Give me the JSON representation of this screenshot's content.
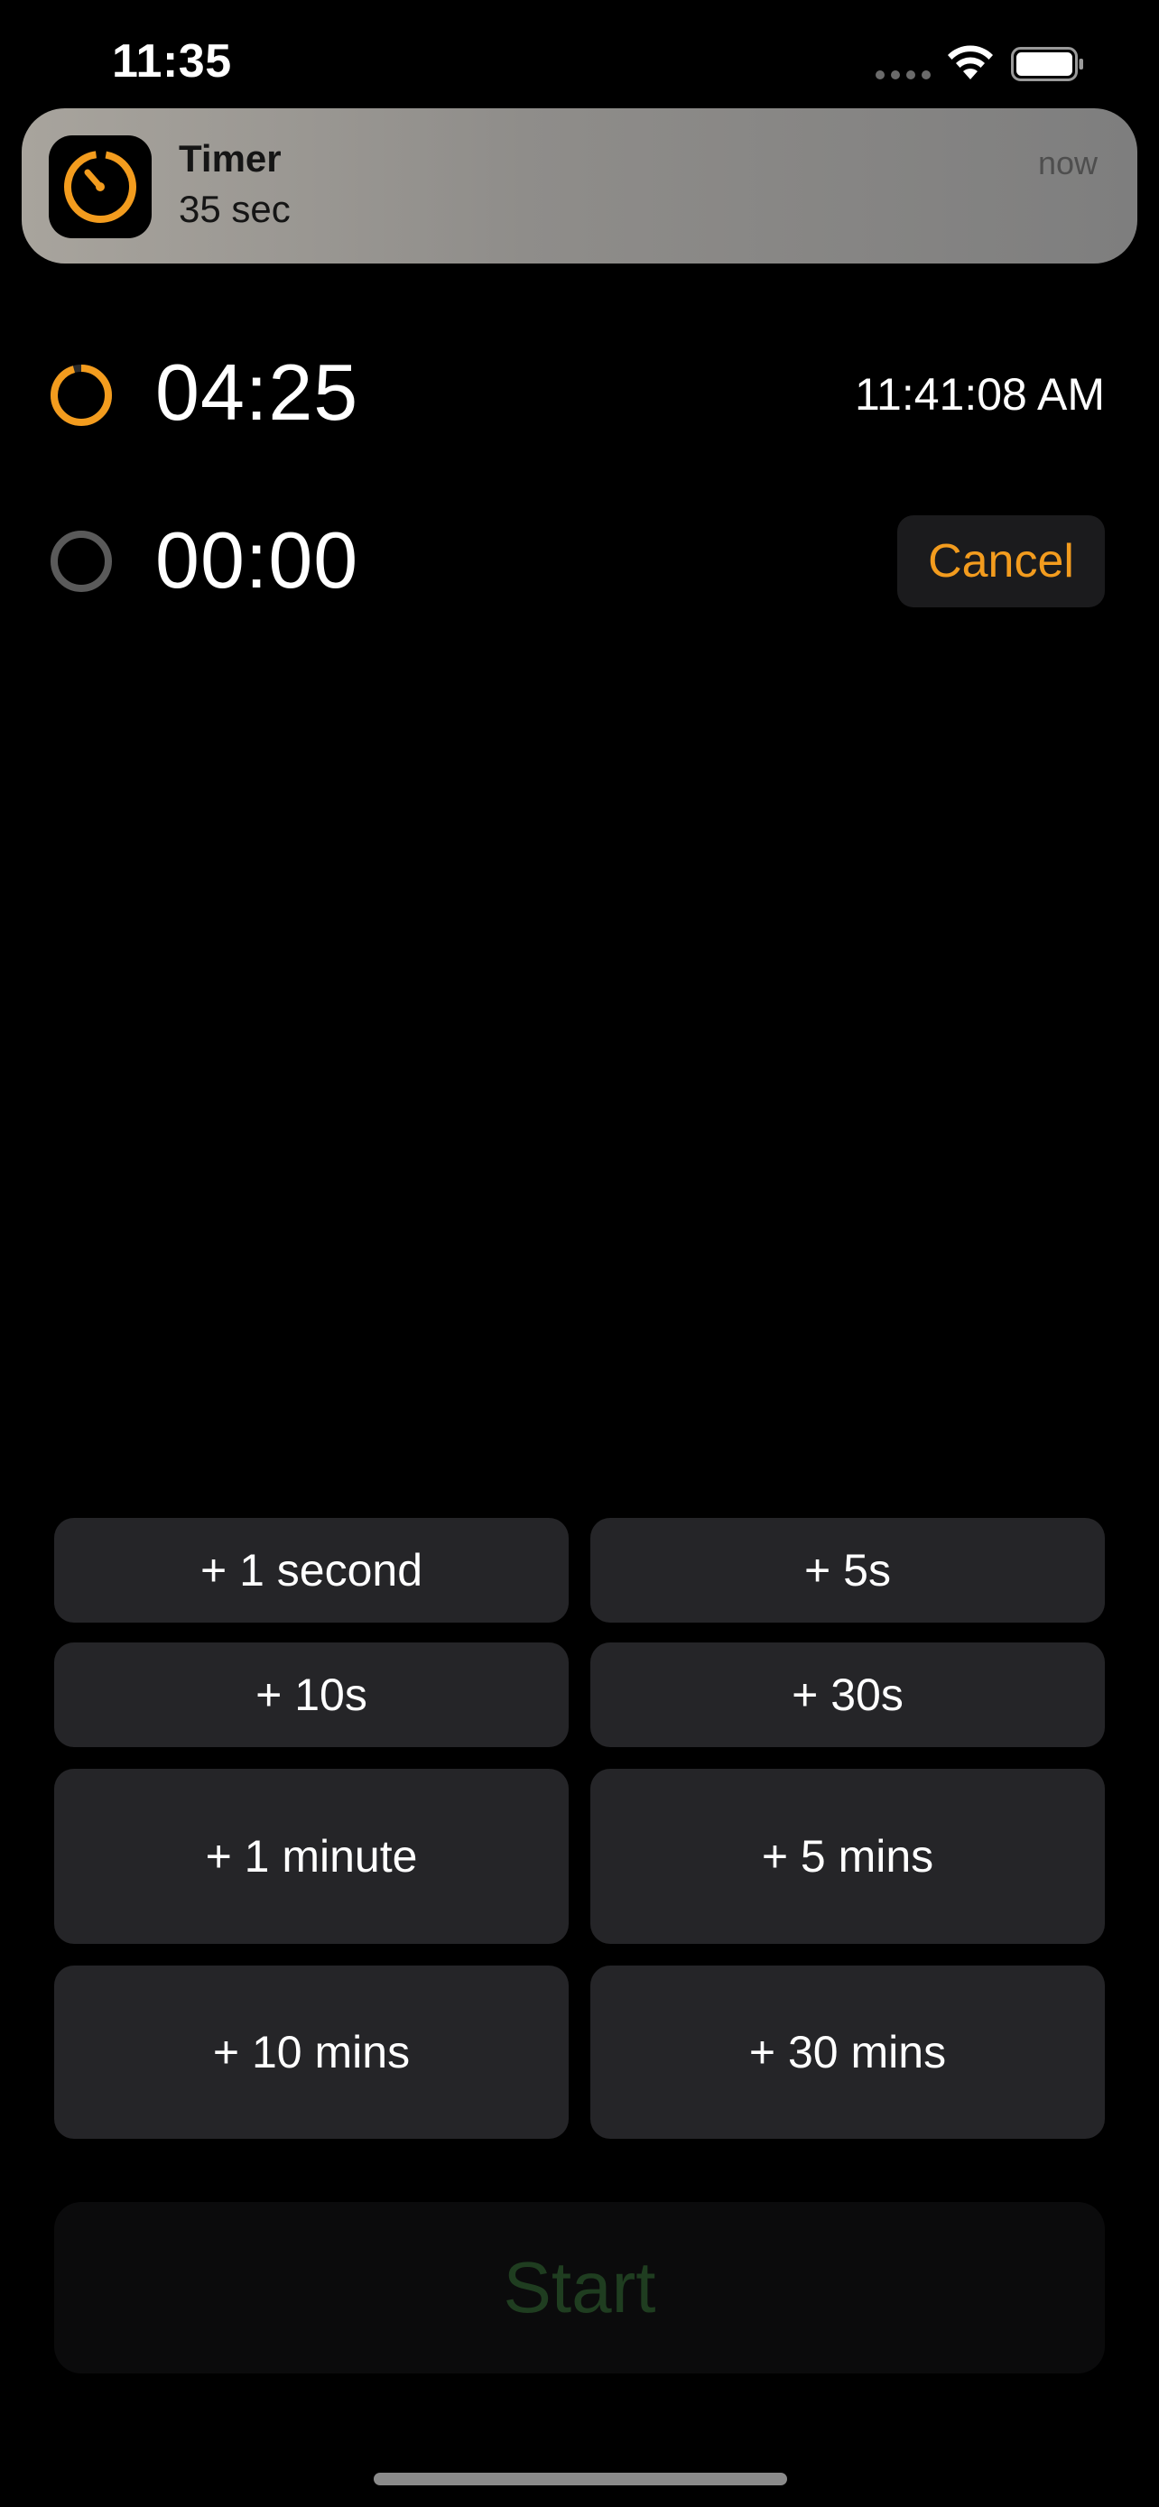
{
  "status_bar": {
    "time": "11:35",
    "icons": [
      "signal-dots-icon",
      "wifi-icon",
      "battery-icon"
    ]
  },
  "notification": {
    "app_name": "Timer",
    "body": "35 sec",
    "time": "now",
    "icon": "timer-icon"
  },
  "timers": [
    {
      "remaining": "04:25",
      "end_time": "11:41:08 AM",
      "progress_ring_color": "#f39c1e",
      "state": "running"
    },
    {
      "remaining": "00:00",
      "action_label": "Cancel",
      "state": "idle"
    }
  ],
  "increment_buttons": [
    {
      "label": "+ 1 second"
    },
    {
      "label": "+ 5s"
    },
    {
      "label": "+ 10s"
    },
    {
      "label": "+ 30s"
    },
    {
      "label": "+ 1 minute"
    },
    {
      "label": "+ 5 mins"
    },
    {
      "label": "+ 10 mins"
    },
    {
      "label": "+ 30 mins"
    }
  ],
  "start_button": {
    "label": "Start",
    "enabled": false
  },
  "colors": {
    "accent": "#f39c1e",
    "background": "#000000",
    "button_bg": "#252528",
    "start_text_disabled": "#1f3d20"
  }
}
